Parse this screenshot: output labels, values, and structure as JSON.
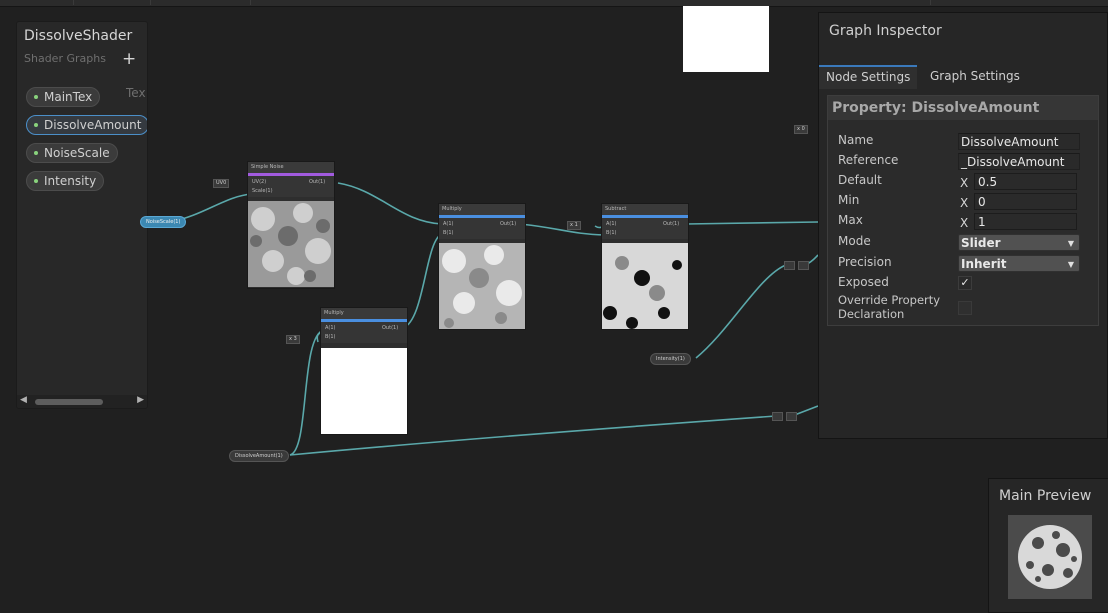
{
  "blackboard": {
    "title": "DissolveShader",
    "subtitle": "Shader Graphs",
    "add_label": "+",
    "properties": [
      {
        "label": "MainTex",
        "type": "Tex",
        "selected": false
      },
      {
        "label": "DissolveAmount",
        "type": "",
        "selected": true
      },
      {
        "label": "NoiseScale",
        "type": "",
        "selected": false
      },
      {
        "label": "Intensity",
        "type": "",
        "selected": false
      }
    ]
  },
  "graph": {
    "nodes": {
      "simple_noise": {
        "title": "Simple Noise",
        "in1": "UV(2)",
        "in2": "Scale(1)",
        "out": "Out(1)"
      },
      "multiply": {
        "title": "Multiply",
        "in1": "A(1)",
        "in2": "B(1)",
        "out": "Out(1)"
      },
      "multiply2": {
        "title": "Multiply",
        "in1": "A(1)",
        "in2": "B(1)",
        "out": "Out(1)"
      },
      "subtract": {
        "title": "Subtract",
        "in1": "A(1)",
        "in2": "B(1)",
        "out": "Out(1)"
      }
    },
    "values": {
      "uv": "UV0",
      "multiply_a": "3",
      "subtract_a": "1",
      "small": "0"
    },
    "property_nodes": {
      "noise_scale": "NoiseScale(1)",
      "intensity": "Intensity(1)",
      "dissolve_amount": "DissolveAmount(1)"
    }
  },
  "inspector": {
    "title": "Graph Inspector",
    "tabs": [
      {
        "label": "Node Settings",
        "active": true
      },
      {
        "label": "Graph Settings",
        "active": false
      }
    ],
    "property_header": "Property: DissolveAmount",
    "fields": {
      "name": {
        "label": "Name",
        "value": "DissolveAmount"
      },
      "reference": {
        "label": "Reference",
        "value": "_DissolveAmount"
      },
      "default": {
        "label": "Default",
        "axis": "X",
        "value": "0.5"
      },
      "min": {
        "label": "Min",
        "axis": "X",
        "value": "0"
      },
      "max": {
        "label": "Max",
        "axis": "X",
        "value": "1"
      },
      "mode": {
        "label": "Mode",
        "value": "Slider"
      },
      "precision": {
        "label": "Precision",
        "value": "Inherit"
      },
      "exposed": {
        "label": "Exposed",
        "checked": true,
        "mark": "✓"
      },
      "override": {
        "label_line1": "Override Property",
        "label_line2": "Declaration",
        "checked": false
      }
    }
  },
  "main_preview": {
    "title": "Main Preview"
  },
  "colors": {
    "wire": "#5aa8aa",
    "node_header_purple": "#a25bdf",
    "node_header_blue": "#4a8fe0",
    "selection_blue": "#4b8fc9",
    "active_tab": "#3a79bb",
    "property_dot": "#89d37d"
  }
}
